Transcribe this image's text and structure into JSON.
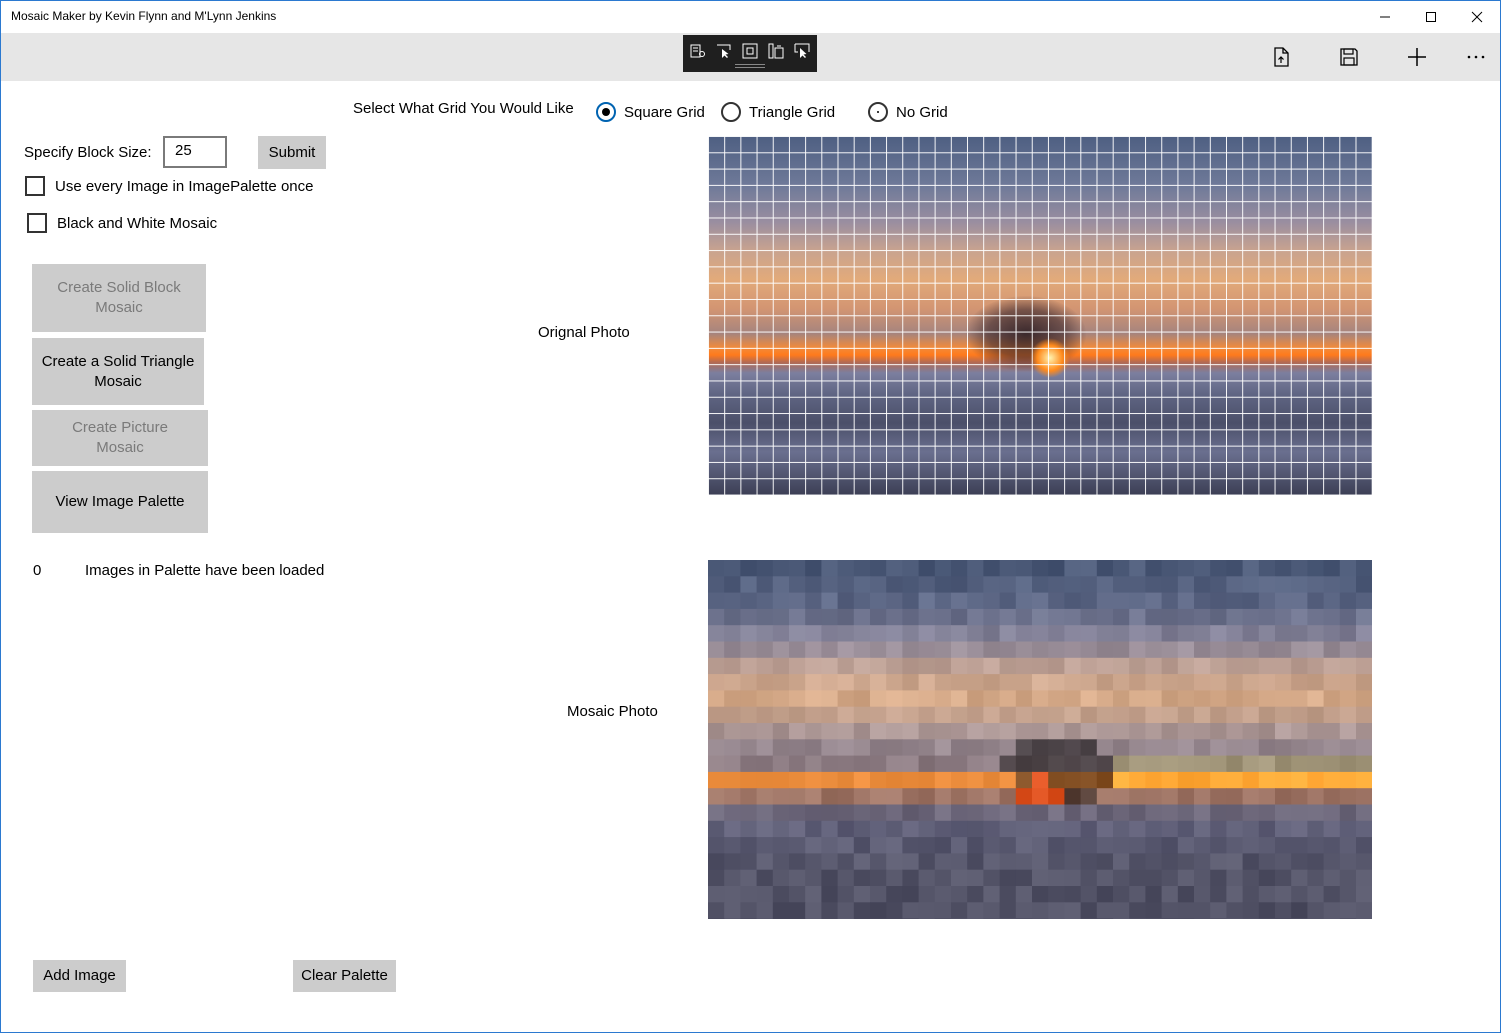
{
  "window": {
    "title": "Mosaic Maker by Kevin Flynn and M'Lynn Jenkins"
  },
  "grid_selector": {
    "prompt": "Select What Grid You Would Like",
    "options": [
      {
        "label": "Square Grid",
        "selected": true
      },
      {
        "label": "Triangle Grid",
        "selected": false
      },
      {
        "label": "No Grid",
        "selected": false
      }
    ]
  },
  "block_size": {
    "label": "Specify Block Size:",
    "value": "25",
    "submit_label": "Submit"
  },
  "options": {
    "use_every_image_label": "Use every Image in ImagePalette once",
    "use_every_image_checked": false,
    "black_white_label": "Black and White Mosaic",
    "black_white_checked": false
  },
  "actions": {
    "solid_block_label": "Create Solid Block Mosaic",
    "solid_block_enabled": false,
    "solid_triangle_label": "Create a Solid Triangle Mosaic",
    "solid_triangle_enabled": true,
    "picture_mosaic_label": "Create Picture Mosaic",
    "picture_mosaic_enabled": false,
    "view_palette_label": "View Image Palette"
  },
  "palette": {
    "count": "0",
    "status_text": "Images in Palette have been loaded",
    "add_image_label": "Add Image",
    "clear_palette_label": "Clear Palette"
  },
  "photos": {
    "original_label": "Orignal Photo",
    "mosaic_label": "Mosaic Photo"
  },
  "icons": {
    "debug_toolbar": [
      "live-visual-tree-icon",
      "select-element-icon",
      "display-layout-adorners-icon",
      "track-focus-icon",
      "preview-selection-icon"
    ],
    "command_bar": [
      "open-file-icon",
      "save-icon",
      "add-icon",
      "more-icon"
    ]
  },
  "colors": {
    "accent": "#0063b1",
    "button_bg": "#cccccc",
    "command_bar_bg": "#e6e6e6",
    "disabled_text": "#7a7a7a"
  }
}
